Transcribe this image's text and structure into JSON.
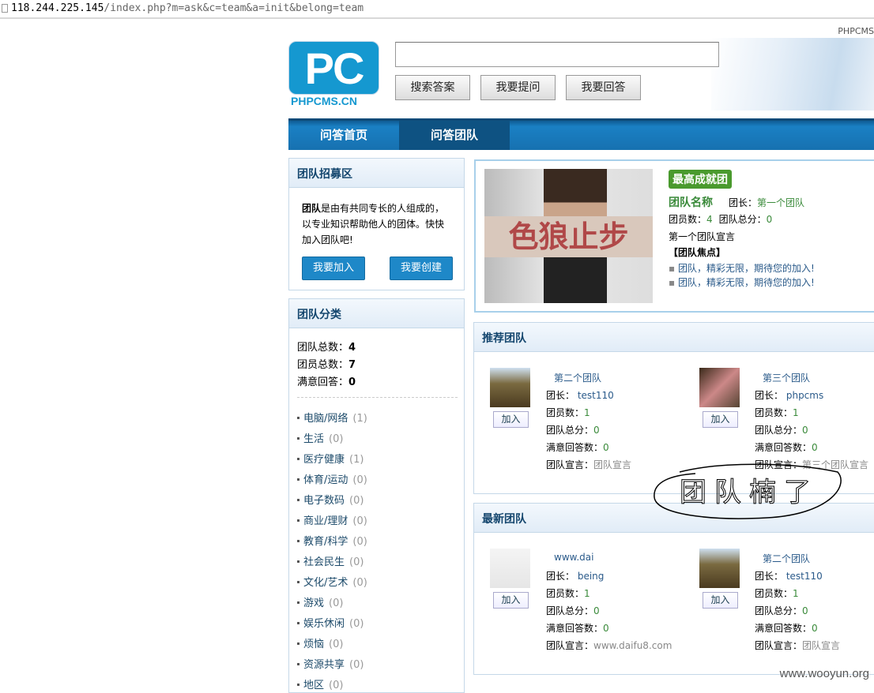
{
  "browser": {
    "url_host": "118.244.225.145",
    "url_path": "/index.php?m=ask&c=team&a=init&belong=team"
  },
  "header": {
    "top_link": "PHPCMS",
    "logo_text": "PC",
    "logo_domain": "PHPCMS.CN",
    "search_value": "",
    "buttons": [
      "搜索答案",
      "我要提问",
      "我要回答"
    ]
  },
  "nav": {
    "tabs": [
      {
        "label": "问答首页",
        "active": false
      },
      {
        "label": "问答团队",
        "active": true
      }
    ]
  },
  "recruit": {
    "title": "团队招募区",
    "desc_bold": "团队",
    "desc": "是由有共同专长的人组成的，以专业知识帮助他人的团体。快快加入团队吧!",
    "join": "我要加入",
    "create": "我要创建"
  },
  "categories": {
    "title": "团队分类",
    "stats": [
      {
        "label": "团队总数：",
        "value": "4"
      },
      {
        "label": "团员总数：",
        "value": "7"
      },
      {
        "label": "满意回答：",
        "value": "0"
      }
    ],
    "items": [
      {
        "name": "电脑/网络",
        "count": "(1)"
      },
      {
        "name": "生活",
        "count": "(0)"
      },
      {
        "name": "医疗健康",
        "count": "(1)"
      },
      {
        "name": "体育/运动",
        "count": "(0)"
      },
      {
        "name": "电子数码",
        "count": "(0)"
      },
      {
        "name": "商业/理财",
        "count": "(0)"
      },
      {
        "name": "教育/科学",
        "count": "(0)"
      },
      {
        "name": "社会民生",
        "count": "(0)"
      },
      {
        "name": "文化/艺术",
        "count": "(0)"
      },
      {
        "name": "游戏",
        "count": "(0)"
      },
      {
        "name": "娱乐休闲",
        "count": "(0)"
      },
      {
        "name": "烦恼",
        "count": "(0)"
      },
      {
        "name": "资源共享",
        "count": "(0)"
      },
      {
        "name": "地区",
        "count": "(0)"
      }
    ]
  },
  "featured": {
    "badge": "最高成就团",
    "image_text": "色狼止步",
    "name": "团队名称",
    "leader_label": "团长：",
    "leader": "第一个团队",
    "members_label": "团员数：",
    "members": "4",
    "score_label": "团队总分：",
    "score": "0",
    "slogan": "第一个团队宣言",
    "focus_title": "【团队焦点】",
    "focus_items": [
      "团队，精彩无限，期待您的加入!",
      "团队，精彩无限，期待您的加入!"
    ]
  },
  "labels": {
    "leader": "团长：",
    "members": "团员数：",
    "score": "团队总分：",
    "answers": "满意回答数：",
    "slogan": "团队宣言：",
    "join": "加入"
  },
  "recommended": {
    "title": "推荐团队",
    "teams": [
      {
        "name": "第二个团队",
        "leader": "test110",
        "members": "1",
        "score": "0",
        "answers": "0",
        "slogan": "团队宣言"
      },
      {
        "name": "第三个团队",
        "leader": "phpcms",
        "members": "1",
        "score": "0",
        "answers": "0",
        "slogan": "第三个团队宣言"
      }
    ]
  },
  "newest": {
    "title": "最新团队",
    "teams": [
      {
        "name": "www.dai",
        "leader": "being",
        "members": "1",
        "score": "0",
        "answers": "0",
        "slogan": "www.daifu8.com"
      },
      {
        "name": "第二个团队",
        "leader": "test110",
        "members": "1",
        "score": "0",
        "answers": "0",
        "slogan": "团队宣言"
      }
    ]
  },
  "annotation": "团队楠了",
  "watermark": "www.wooyun.org"
}
